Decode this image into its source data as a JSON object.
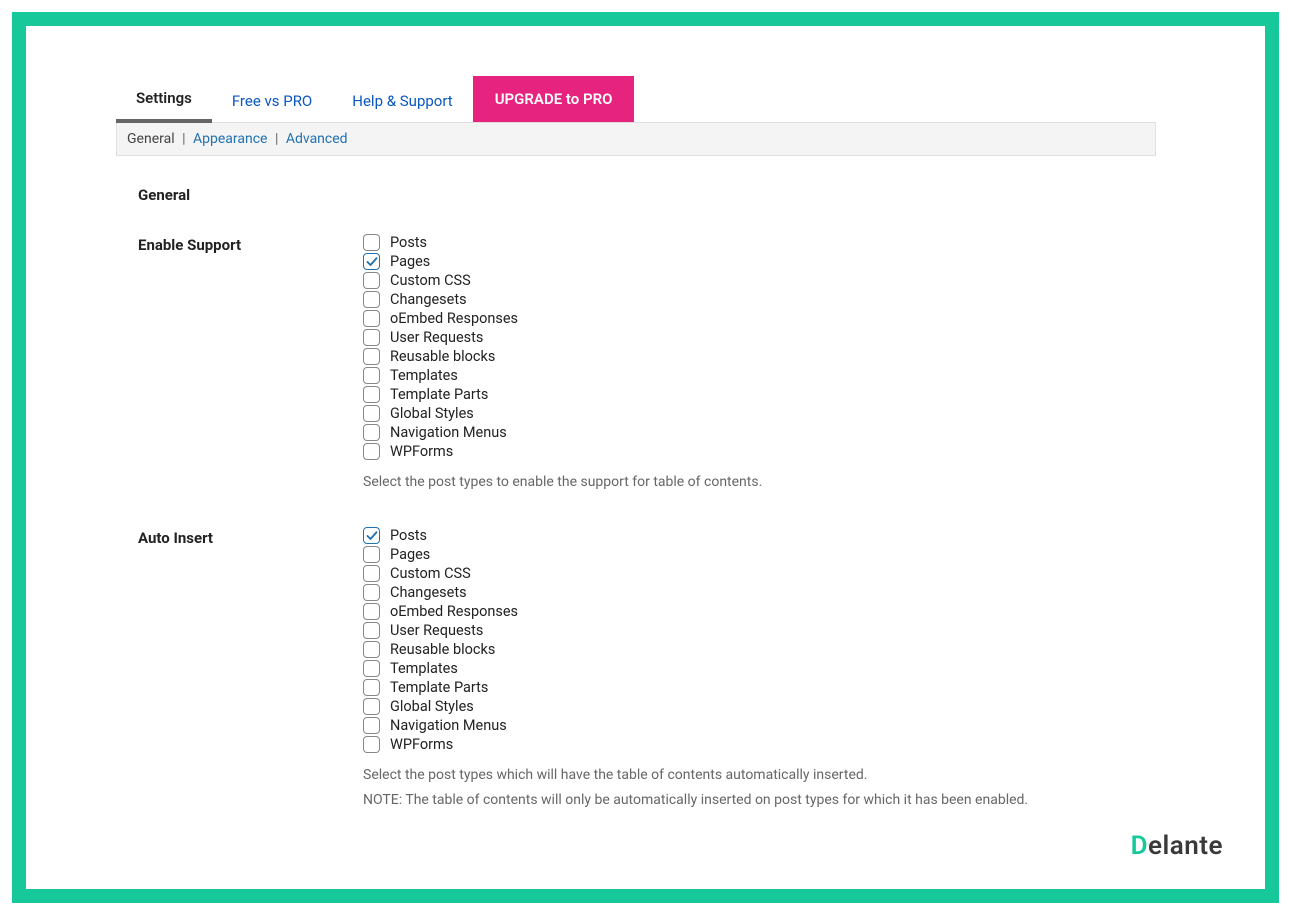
{
  "tabs": {
    "settings": "Settings",
    "freevspro": "Free vs PRO",
    "help": "Help & Support",
    "upgrade": "UPGRADE to PRO"
  },
  "subnav": {
    "general": "General",
    "appearance": "Appearance",
    "advanced": "Advanced"
  },
  "section_title": "General",
  "enable_support": {
    "label": "Enable Support",
    "items": [
      {
        "label": "Posts",
        "checked": false
      },
      {
        "label": "Pages",
        "checked": true
      },
      {
        "label": "Custom CSS",
        "checked": false
      },
      {
        "label": "Changesets",
        "checked": false
      },
      {
        "label": "oEmbed Responses",
        "checked": false
      },
      {
        "label": "User Requests",
        "checked": false
      },
      {
        "label": "Reusable blocks",
        "checked": false
      },
      {
        "label": "Templates",
        "checked": false
      },
      {
        "label": "Template Parts",
        "checked": false
      },
      {
        "label": "Global Styles",
        "checked": false
      },
      {
        "label": "Navigation Menus",
        "checked": false
      },
      {
        "label": "WPForms",
        "checked": false
      }
    ],
    "help": "Select the post types to enable the support for table of contents."
  },
  "auto_insert": {
    "label": "Auto Insert",
    "items": [
      {
        "label": "Posts",
        "checked": true
      },
      {
        "label": "Pages",
        "checked": false
      },
      {
        "label": "Custom CSS",
        "checked": false
      },
      {
        "label": "Changesets",
        "checked": false
      },
      {
        "label": "oEmbed Responses",
        "checked": false
      },
      {
        "label": "User Requests",
        "checked": false
      },
      {
        "label": "Reusable blocks",
        "checked": false
      },
      {
        "label": "Templates",
        "checked": false
      },
      {
        "label": "Template Parts",
        "checked": false
      },
      {
        "label": "Global Styles",
        "checked": false
      },
      {
        "label": "Navigation Menus",
        "checked": false
      },
      {
        "label": "WPForms",
        "checked": false
      }
    ],
    "help1": "Select the post types which will have the table of contents automatically inserted.",
    "help2": "NOTE: The table of contents will only be automatically inserted on post types for which it has been enabled."
  },
  "logo": {
    "d": "D",
    "rest": "elante"
  }
}
